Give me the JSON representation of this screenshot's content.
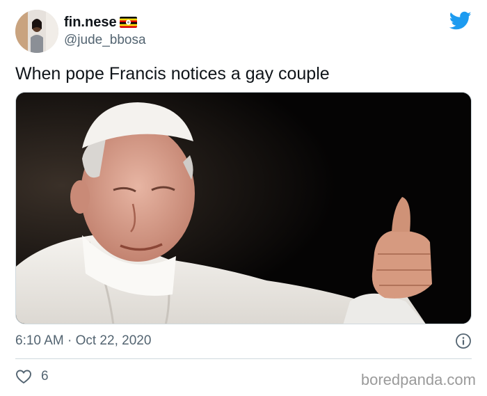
{
  "author": {
    "display_name": "fin.nese",
    "handle": "@jude_bbosa",
    "flag_icon": "uganda-flag-icon"
  },
  "tweet": {
    "text": "When pope Francis notices a gay couple",
    "timestamp": "6:10 AM · Oct 22, 2020",
    "like_count": "6"
  },
  "icons": {
    "brand": "twitter-bird-icon",
    "info": "info-icon",
    "like": "heart-icon"
  },
  "watermark": "boredpanda.com",
  "colors": {
    "twitter_blue": "#1d9bf0",
    "secondary_text": "#536471",
    "divider": "#cfd9de"
  }
}
